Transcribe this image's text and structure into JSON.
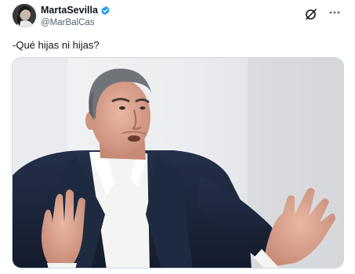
{
  "tweet": {
    "display_name": "MartaSevilla",
    "handle": "@MarBalCas",
    "verified": true,
    "text": "-Qué hijas ni hijas?",
    "verified_color": "#1d9bf0"
  },
  "icons": {
    "verified": "verified-badge-icon",
    "grok": "grok-icon",
    "more": "more-options-icon"
  },
  "media": {
    "type": "photo",
    "subject": "older man with grey hair in dark suit and white shirt gesturing with both hands"
  }
}
